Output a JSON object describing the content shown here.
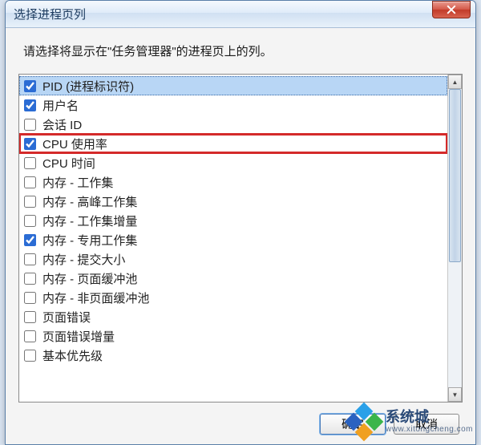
{
  "window": {
    "title": "选择进程页列"
  },
  "instruction": "请选择将显示在\"任务管理器\"的进程页上的列。",
  "columns": [
    {
      "label": "PID (进程标识符)",
      "checked": true,
      "selected": true
    },
    {
      "label": "用户名",
      "checked": true
    },
    {
      "label": "会话 ID",
      "checked": false
    },
    {
      "label": "CPU 使用率",
      "checked": true,
      "highlighted": true
    },
    {
      "label": "CPU 时间",
      "checked": false
    },
    {
      "label": "内存 - 工作集",
      "checked": false
    },
    {
      "label": "内存 - 高峰工作集",
      "checked": false
    },
    {
      "label": "内存 - 工作集增量",
      "checked": false
    },
    {
      "label": "内存 - 专用工作集",
      "checked": true
    },
    {
      "label": "内存 - 提交大小",
      "checked": false
    },
    {
      "label": "内存 - 页面缓冲池",
      "checked": false
    },
    {
      "label": "内存 - 非页面缓冲池",
      "checked": false
    },
    {
      "label": "页面错误",
      "checked": false
    },
    {
      "label": "页面错误增量",
      "checked": false
    },
    {
      "label": "基本优先级",
      "checked": false
    }
  ],
  "buttons": {
    "ok": "确定",
    "cancel": "取消"
  },
  "watermark": {
    "cn": "系统城",
    "en": "www.xitongcheng.com"
  }
}
